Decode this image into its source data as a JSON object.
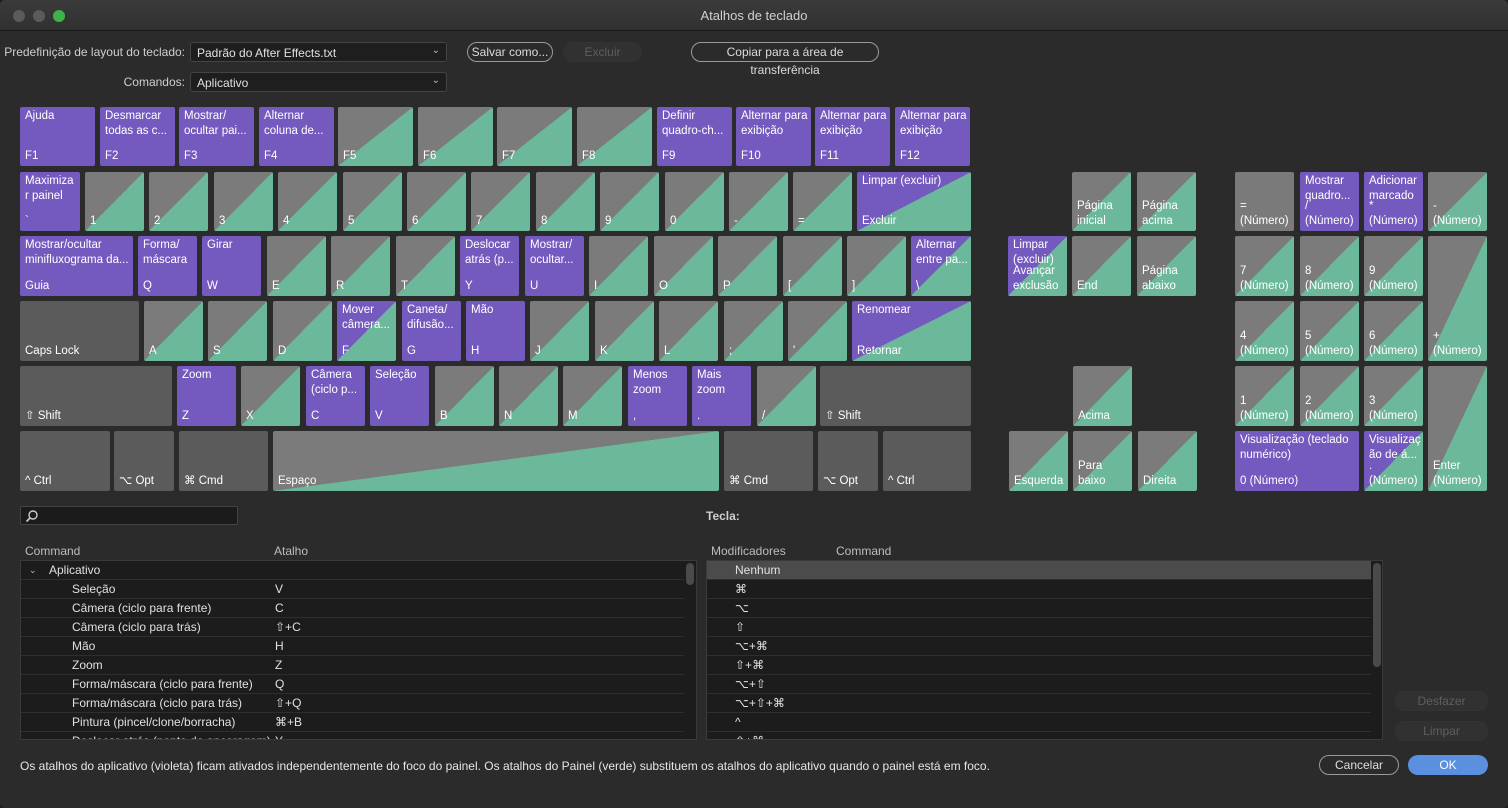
{
  "window": {
    "title": "Atalhos de teclado"
  },
  "preset": {
    "label": "Predefinição de layout do teclado:",
    "value": "Padrão do After Effects.txt"
  },
  "commands": {
    "label": "Comandos:",
    "value": "Aplicativo"
  },
  "toolbar": {
    "save_as": "Salvar como...",
    "delete": "Excluir",
    "copy": "Copiar para a área de transferência"
  },
  "colors": {
    "application": "#7459be",
    "panel": "#6cb89a",
    "unassigned": "#7b7b7b"
  },
  "keys": [
    {
      "key": "F1",
      "command": "Ajuda",
      "type": "app"
    },
    {
      "key": "F2",
      "command": "Desmarcar todas as c...",
      "type": "app"
    },
    {
      "key": "F3",
      "command": "Mostrar/ ocultar pai...",
      "type": "app"
    },
    {
      "key": "F4",
      "command": "Alternar coluna de...",
      "type": "app"
    },
    {
      "key": "F5",
      "command": "",
      "type": "panel"
    },
    {
      "key": "F6",
      "command": "",
      "type": "panel"
    },
    {
      "key": "F7",
      "command": "",
      "type": "panel"
    },
    {
      "key": "F8",
      "command": "",
      "type": "panel"
    },
    {
      "key": "F9",
      "command": "Definir quadro-ch...",
      "type": "app"
    },
    {
      "key": "F10",
      "command": "Alternar para exibição",
      "type": "app"
    },
    {
      "key": "F11",
      "command": "Alternar para exibição",
      "type": "app"
    },
    {
      "key": "F12",
      "command": "Alternar para exibição",
      "type": "app"
    },
    {
      "key": "`",
      "command": "Maximiza r painel",
      "type": "app"
    },
    {
      "key": "1",
      "command": "",
      "type": "panel"
    },
    {
      "key": "2",
      "command": "",
      "type": "panel"
    },
    {
      "key": "3",
      "command": "",
      "type": "panel"
    },
    {
      "key": "4",
      "command": "",
      "type": "panel"
    },
    {
      "key": "5",
      "command": "",
      "type": "panel"
    },
    {
      "key": "6",
      "command": "",
      "type": "panel"
    },
    {
      "key": "7",
      "command": "",
      "type": "panel"
    },
    {
      "key": "8",
      "command": "",
      "type": "panel"
    },
    {
      "key": "9",
      "command": "",
      "type": "panel"
    },
    {
      "key": "0",
      "command": "",
      "type": "panel"
    },
    {
      "key": "-",
      "command": "",
      "type": "panel"
    },
    {
      "key": "=",
      "command": "",
      "type": "panel"
    },
    {
      "key": "Excluir",
      "command": "Limpar (excluir)",
      "type": "mixed"
    },
    {
      "key": "Guia",
      "command": "Mostrar/ocultar minifluxograma da...",
      "type": "app"
    },
    {
      "key": "Q",
      "command": "Forma/ máscara",
      "type": "app"
    },
    {
      "key": "W",
      "command": "Girar",
      "type": "app"
    },
    {
      "key": "E",
      "command": "",
      "type": "panel"
    },
    {
      "key": "R",
      "command": "",
      "type": "panel"
    },
    {
      "key": "T",
      "command": "",
      "type": "panel"
    },
    {
      "key": "Y",
      "command": "Deslocar atrás (p...",
      "type": "app"
    },
    {
      "key": "U",
      "command": "Mostrar/ ocultar...",
      "type": "app"
    },
    {
      "key": "I",
      "command": "",
      "type": "panel"
    },
    {
      "key": "O",
      "command": "",
      "type": "panel"
    },
    {
      "key": "P",
      "command": "",
      "type": "panel"
    },
    {
      "key": "[",
      "command": "",
      "type": "panel"
    },
    {
      "key": "]",
      "command": "",
      "type": "panel"
    },
    {
      "key": "\\",
      "command": "Alternar entre pa...",
      "type": "mixed"
    },
    {
      "key": "Caps Lock",
      "command": "",
      "type": "mod"
    },
    {
      "key": "A",
      "command": "",
      "type": "panel"
    },
    {
      "key": "S",
      "command": "",
      "type": "panel"
    },
    {
      "key": "D",
      "command": "",
      "type": "panel"
    },
    {
      "key": "F",
      "command": "Mover câmera...",
      "type": "mixed"
    },
    {
      "key": "G",
      "command": "Caneta/ difusão...",
      "type": "app"
    },
    {
      "key": "H",
      "command": "Mão",
      "type": "app"
    },
    {
      "key": "J",
      "command": "",
      "type": "panel"
    },
    {
      "key": "K",
      "command": "",
      "type": "panel"
    },
    {
      "key": "L",
      "command": "",
      "type": "panel"
    },
    {
      "key": ";",
      "command": "",
      "type": "panel"
    },
    {
      "key": "'",
      "command": "",
      "type": "panel"
    },
    {
      "key": "Retornar",
      "command": "Renomear",
      "type": "mixed"
    },
    {
      "key": "⇧ Shift",
      "command": "",
      "type": "mod"
    },
    {
      "key": "Z",
      "command": "Zoom",
      "type": "app"
    },
    {
      "key": "X",
      "command": "",
      "type": "panel"
    },
    {
      "key": "C",
      "command": "Câmera (ciclo p...",
      "type": "app"
    },
    {
      "key": "V",
      "command": "Seleção",
      "type": "app"
    },
    {
      "key": "B",
      "command": "",
      "type": "panel"
    },
    {
      "key": "N",
      "command": "",
      "type": "panel"
    },
    {
      "key": "M",
      "command": "",
      "type": "panel"
    },
    {
      "key": ",",
      "command": "Menos zoom",
      "type": "app"
    },
    {
      "key": ".",
      "command": "Mais zoom",
      "type": "app"
    },
    {
      "key": "/",
      "command": "",
      "type": "panel"
    },
    {
      "key": "⇧ Shift",
      "command": "",
      "type": "mod"
    },
    {
      "key": "^ Ctrl",
      "command": "",
      "type": "mod"
    },
    {
      "key": "⌥ Opt",
      "command": "",
      "type": "mod"
    },
    {
      "key": "⌘ Cmd",
      "command": "",
      "type": "mod"
    },
    {
      "key": "Espaço",
      "command": "",
      "type": "panel"
    },
    {
      "key": "⌘ Cmd",
      "command": "",
      "type": "mod"
    },
    {
      "key": "⌥ Opt",
      "command": "",
      "type": "mod"
    },
    {
      "key": "^ Ctrl",
      "command": "",
      "type": "mod"
    },
    {
      "key": "Página inicial",
      "command": "",
      "type": "panel"
    },
    {
      "key": "Página acima",
      "command": "",
      "type": "panel"
    },
    {
      "key": "Avançar exclusão",
      "command": "Limpar (excluir)",
      "type": "mixed"
    },
    {
      "key": "End",
      "command": "",
      "type": "panel"
    },
    {
      "key": "Página abaixo",
      "command": "",
      "type": "panel"
    },
    {
      "key": "Acima",
      "command": "",
      "type": "panel"
    },
    {
      "key": "Esquerda",
      "command": "",
      "type": "panel"
    },
    {
      "key": "Para baixo",
      "command": "",
      "type": "panel"
    },
    {
      "key": "Direita",
      "command": "",
      "type": "panel"
    },
    {
      "key": "= (Número)",
      "command": "",
      "type": "none"
    },
    {
      "key": "/ (Número)",
      "command": "Mostrar quadro...",
      "type": "app"
    },
    {
      "key": "* (Número)",
      "command": "Adicionar marcado",
      "type": "app"
    },
    {
      "key": "- (Número)",
      "command": "",
      "type": "panel"
    },
    {
      "key": "7 (Número)",
      "command": "",
      "type": "panel"
    },
    {
      "key": "8 (Número)",
      "command": "",
      "type": "panel"
    },
    {
      "key": "9 (Número)",
      "command": "",
      "type": "panel"
    },
    {
      "key": "+ (Número)",
      "command": "",
      "type": "panel"
    },
    {
      "key": "4 (Número)",
      "command": "",
      "type": "panel"
    },
    {
      "key": "5 (Número)",
      "command": "",
      "type": "panel"
    },
    {
      "key": "6 (Número)",
      "command": "",
      "type": "panel"
    },
    {
      "key": "1 (Número)",
      "command": "",
      "type": "panel"
    },
    {
      "key": "2 (Número)",
      "command": "",
      "type": "panel"
    },
    {
      "key": "3 (Número)",
      "command": "",
      "type": "panel"
    },
    {
      "key": "Enter (Número)",
      "command": "",
      "type": "panel"
    },
    {
      "key": "0 (Número)",
      "command": "Visualização (teclado numérico)",
      "type": "app"
    },
    {
      "key": ". (Número)",
      "command": "Visualizaç ão de á...",
      "type": "mixed"
    }
  ],
  "search": {
    "placeholder": ""
  },
  "left_table": {
    "headers": [
      "Command",
      "Atalho"
    ],
    "group": "Aplicativo",
    "rows": [
      {
        "command": "Seleção",
        "shortcut": "V"
      },
      {
        "command": "Câmera (ciclo para frente)",
        "shortcut": "C"
      },
      {
        "command": "Câmera (ciclo para trás)",
        "shortcut": "⇧+C"
      },
      {
        "command": "Mão",
        "shortcut": "H"
      },
      {
        "command": "Zoom",
        "shortcut": "Z"
      },
      {
        "command": "Forma/máscara (ciclo para frente)",
        "shortcut": "Q"
      },
      {
        "command": "Forma/máscara (ciclo para trás)",
        "shortcut": "⇧+Q"
      },
      {
        "command": "Pintura (pincel/clone/borracha)",
        "shortcut": "⌘+B"
      },
      {
        "command": "Deslocar atrás (ponto de ancoragem)",
        "shortcut": "Y"
      }
    ]
  },
  "key_panel": {
    "label": "Tecla:",
    "headers": [
      "Modificadores",
      "Command"
    ],
    "rows": [
      "Nenhum",
      "⌘",
      "⌥",
      "⇧",
      "⌥+⌘",
      "⇧+⌘",
      "⌥+⇧",
      "⌥+⇧+⌘",
      "^",
      "⇧+⌘"
    ]
  },
  "side_buttons": {
    "undo": "Desfazer",
    "clear": "Limpar"
  },
  "footer": {
    "note": "Os atalhos do aplicativo (violeta) ficam ativados independentemente do foco do painel. Os atalhos do Painel (verde) substituem os atalhos do aplicativo quando o painel está em foco.",
    "cancel": "Cancelar",
    "ok": "OK"
  }
}
